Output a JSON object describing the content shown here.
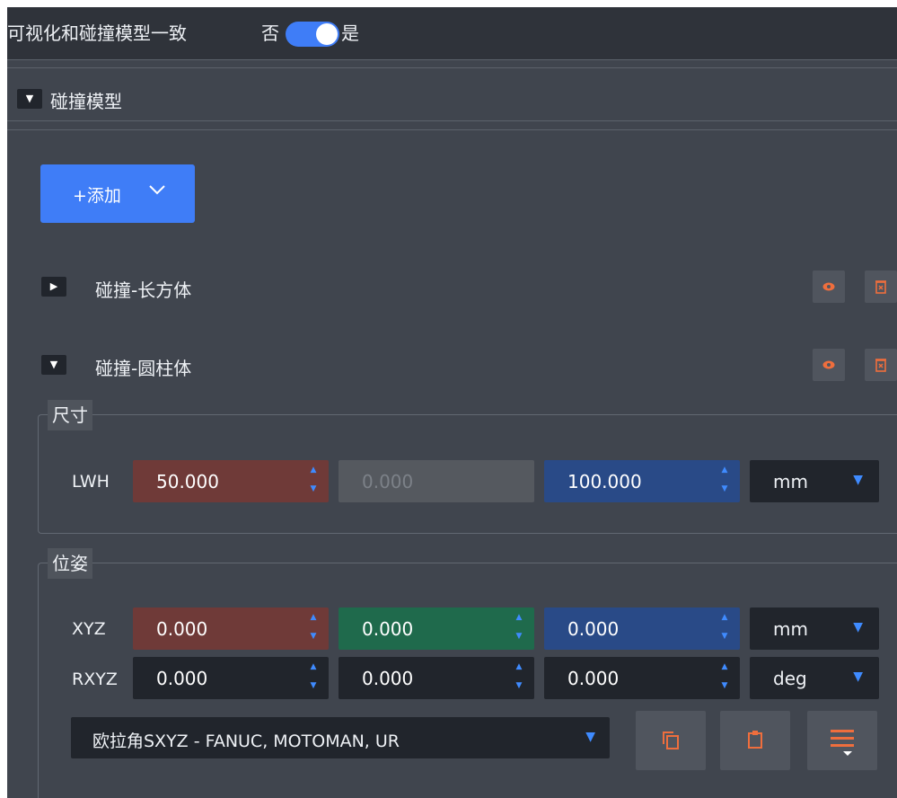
{
  "top": {
    "title": "可视化和碰撞模型一致",
    "off_label": "否",
    "on_label": "是",
    "toggle_on": true
  },
  "section": {
    "label": "碰撞模型",
    "expanded": true
  },
  "add_button": {
    "label": "+添加"
  },
  "items": [
    {
      "label": "碰撞-长方体",
      "expanded": false
    },
    {
      "label": "碰撞-圆柱体",
      "expanded": true
    }
  ],
  "size": {
    "legend": "尺寸",
    "row_label": "LWH",
    "values": [
      "50.000",
      "0.000",
      "100.000"
    ],
    "unit": "mm"
  },
  "pose": {
    "legend": "位姿",
    "xyz": {
      "label": "XYZ",
      "values": [
        "0.000",
        "0.000",
        "0.000"
      ],
      "unit": "mm"
    },
    "rxyz": {
      "label": "RXYZ",
      "values": [
        "0.000",
        "0.000",
        "0.000"
      ],
      "unit": "deg"
    },
    "euler": {
      "selected": "欧拉角SXYZ - FANUC, MOTOMAN, UR"
    }
  },
  "colors": {
    "accent": "#3f7df7",
    "x_axis": "#6f3a38",
    "y_axis": "#1f6a4c",
    "z_axis": "#294a87",
    "icon_orange": "#ef6e3d"
  },
  "icons": [
    "chevron-down-icon",
    "eye-icon",
    "trash-icon",
    "copy-icon",
    "paste-icon",
    "menu-icon"
  ]
}
